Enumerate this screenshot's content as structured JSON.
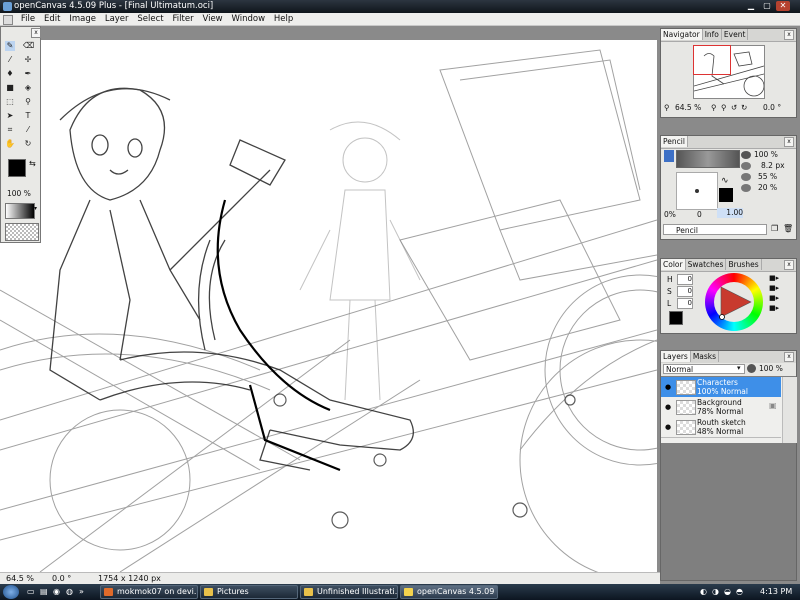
{
  "window": {
    "title": "openCanvas 4.5.09 Plus - [Final Ultimatum.oci]"
  },
  "menu": [
    "File",
    "Edit",
    "Image",
    "Layer",
    "Select",
    "Filter",
    "View",
    "Window",
    "Help"
  ],
  "toolpalette": {
    "brush_size_value": "100",
    "brush_size_unit": "%"
  },
  "navigator": {
    "tabs": [
      "Navigator",
      "Info",
      "Event"
    ],
    "zoom_value": "64.5",
    "zoom_unit": "%",
    "angle_value": "0.0",
    "angle_unit": "°"
  },
  "pencil": {
    "tab": "Pencil",
    "opacity_value": "100",
    "opacity_unit": "%",
    "size_value": "8.2",
    "size_unit": "px",
    "density_value": "55",
    "density_unit": "%",
    "blur_value": "20",
    "blur_unit": "%",
    "min_label": "0%",
    "min_value": "0",
    "max_value": "1.00",
    "preset_name": "Pencil"
  },
  "color": {
    "tabs": [
      "Color",
      "Swatches",
      "Brushes"
    ],
    "h_label": "H",
    "h_value": "0",
    "s_label": "S",
    "s_value": "0",
    "l_label": "L",
    "l_value": "0"
  },
  "layers": {
    "tabs": [
      "Layers",
      "Masks"
    ],
    "blend_mode": "Normal",
    "opacity_value": "100",
    "opacity_unit": "%",
    "items": [
      {
        "name": "Characters",
        "info": "100% Normal",
        "selected": true
      },
      {
        "name": "Background",
        "info": "78% Normal",
        "selected": false
      },
      {
        "name": "Routh sketch",
        "info": "48% Normal",
        "selected": false
      }
    ]
  },
  "statusbar": {
    "zoom": "64.5 %",
    "angle": "0.0 °",
    "size": "1754 x 1240 px"
  },
  "taskbar": {
    "buttons": [
      {
        "label": "mokmok07 on devi...",
        "color": "#e06a2a"
      },
      {
        "label": "Pictures",
        "color": "#e9c14a"
      },
      {
        "label": "Unfinished Illustrati...",
        "color": "#e9c14a"
      },
      {
        "label": "openCanvas 4.5.09 ...",
        "color": "#f3d24d"
      }
    ],
    "clock": "4:13 PM"
  }
}
